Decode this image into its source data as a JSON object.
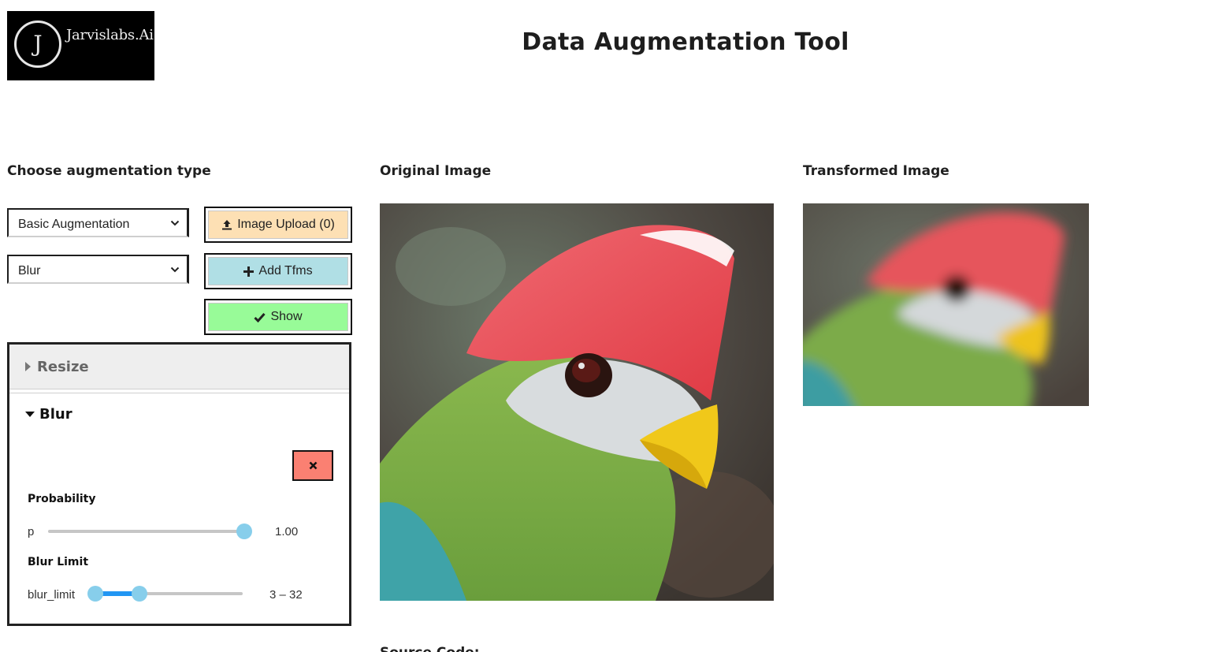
{
  "logo": {
    "letter": "J",
    "text": "Jarvislabs.Ai"
  },
  "app": {
    "title": "Data Augmentation Tool"
  },
  "controls": {
    "heading": "Choose augmentation type",
    "augmentation_type": {
      "selected": "Basic Augmentation"
    },
    "transform": {
      "selected": "Blur"
    },
    "upload_label": "Image Upload (0)",
    "add_label": "Add Tfms",
    "show_label": "Show"
  },
  "accordion": {
    "resize_title": "Resize",
    "blur_title": "Blur",
    "probability": {
      "label": "Probability",
      "name": "p",
      "value": "1.00",
      "fraction": 1.0
    },
    "blur_limit": {
      "label": "Blur Limit",
      "name": "blur_limit",
      "value": "3 – 32",
      "low": 3,
      "high": 32
    }
  },
  "original": {
    "heading": "Original Image"
  },
  "transformed": {
    "heading": "Transformed Image"
  },
  "source": {
    "heading": "Source Code:"
  },
  "colors": {
    "upload_bg": "#fde0b4",
    "add_bg": "#b0dfe5",
    "show_bg": "#98fb98",
    "remove_bg": "#fa8072",
    "slider_knob": "#87ceeb",
    "slider_fill": "#2196f3"
  },
  "icons": {
    "upload": "upload-icon",
    "add": "plus-icon",
    "show": "check-icon",
    "remove": "close-icon",
    "collapsed": "caret-right-icon",
    "expanded": "caret-down-icon",
    "select": "chevron-down-icon"
  }
}
